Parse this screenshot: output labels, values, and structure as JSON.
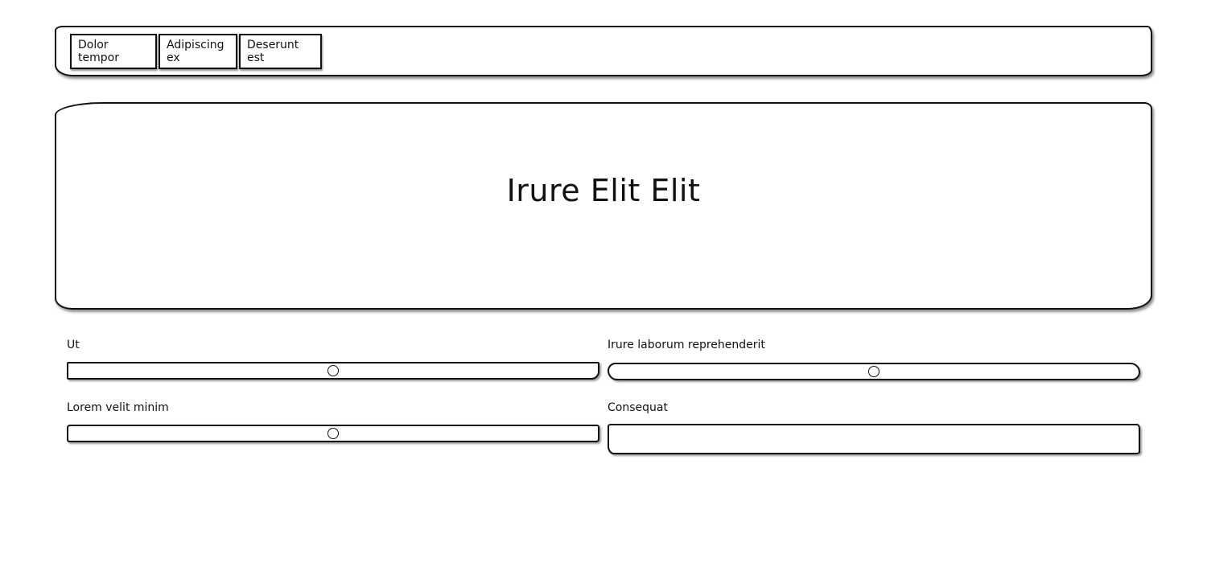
{
  "nav": {
    "tabs": [
      {
        "label": "Dolor tempor"
      },
      {
        "label": "Adipiscing ex"
      },
      {
        "label": "Deserunt est"
      }
    ]
  },
  "hero": {
    "title": "Irure Elit Elit"
  },
  "fields": {
    "slider_1": {
      "label": "Ut",
      "value": 0.5
    },
    "slider_2": {
      "label": "Irure laborum reprehenderit",
      "value": 0.5
    },
    "slider_3": {
      "label": "Lorem velit minim",
      "value": 0.5
    },
    "text_1": {
      "label": "Consequat",
      "value": ""
    }
  }
}
